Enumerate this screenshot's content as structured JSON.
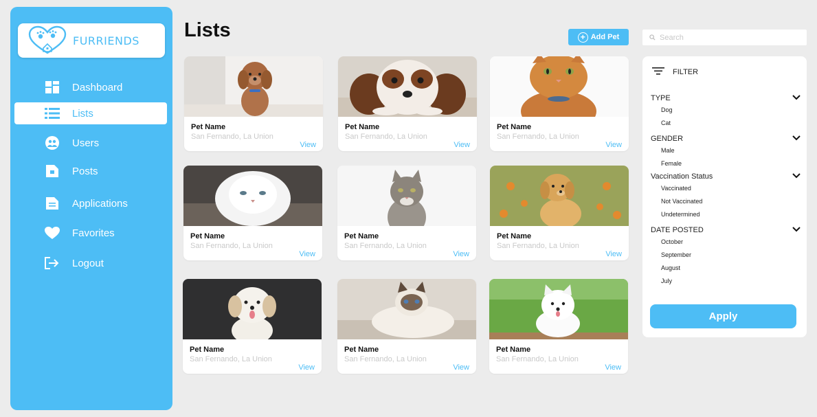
{
  "brand": {
    "name": "FURRIENDS",
    "color": "#4dbdf5"
  },
  "sidebar": {
    "items": [
      {
        "label": "Dashboard",
        "icon": "dashboard-icon",
        "active": false
      },
      {
        "label": "Lists",
        "icon": "list-icon",
        "active": true
      },
      {
        "label": "Users",
        "icon": "users-icon",
        "active": false
      },
      {
        "label": "Posts",
        "icon": "posts-icon",
        "active": false
      },
      {
        "label": "Applications",
        "icon": "applications-icon",
        "active": false
      },
      {
        "label": "Favorites",
        "icon": "heart-icon",
        "active": false
      },
      {
        "label": "Logout",
        "icon": "logout-icon",
        "active": false
      }
    ]
  },
  "header": {
    "title": "Lists",
    "add_button_label": "Add Pet",
    "search_placeholder": "Search"
  },
  "cards": [
    {
      "name": "Pet Name",
      "location": "San Fernando, La Union",
      "action": "View",
      "photo": "curly-brown-puppy"
    },
    {
      "name": "Pet Name",
      "location": "San Fernando, La Union",
      "action": "View",
      "photo": "spaniel-lying-down"
    },
    {
      "name": "Pet Name",
      "location": "San Fernando, La Union",
      "action": "View",
      "photo": "orange-tabby-cat"
    },
    {
      "name": "Pet Name",
      "location": "San Fernando, La Union",
      "action": "View",
      "photo": "white-persian-cat"
    },
    {
      "name": "Pet Name",
      "location": "San Fernando, La Union",
      "action": "View",
      "photo": "gray-tabby-cat"
    },
    {
      "name": "Pet Name",
      "location": "San Fernando, La Union",
      "action": "View",
      "photo": "golden-retriever-puppy"
    },
    {
      "name": "Pet Name",
      "location": "San Fernando, La Union",
      "action": "View",
      "photo": "shih-tzu-puppy"
    },
    {
      "name": "Pet Name",
      "location": "San Fernando, La Union",
      "action": "View",
      "photo": "ragdoll-cat"
    },
    {
      "name": "Pet Name",
      "location": "San Fernando, La Union",
      "action": "View",
      "photo": "white-samoyed-puppy"
    }
  ],
  "filter": {
    "title": "FILTER",
    "groups": [
      {
        "title": "TYPE",
        "options": [
          "Dog",
          "Cat"
        ]
      },
      {
        "title": "GENDER",
        "options": [
          "Male",
          "Female"
        ]
      },
      {
        "title": "Vaccination Status",
        "options": [
          "Vaccinated",
          "Not Vaccinated",
          "Undetermined"
        ]
      },
      {
        "title": "DATE POSTED",
        "options": [
          "October",
          "September",
          "August",
          "July"
        ]
      }
    ],
    "apply_label": "Apply"
  }
}
